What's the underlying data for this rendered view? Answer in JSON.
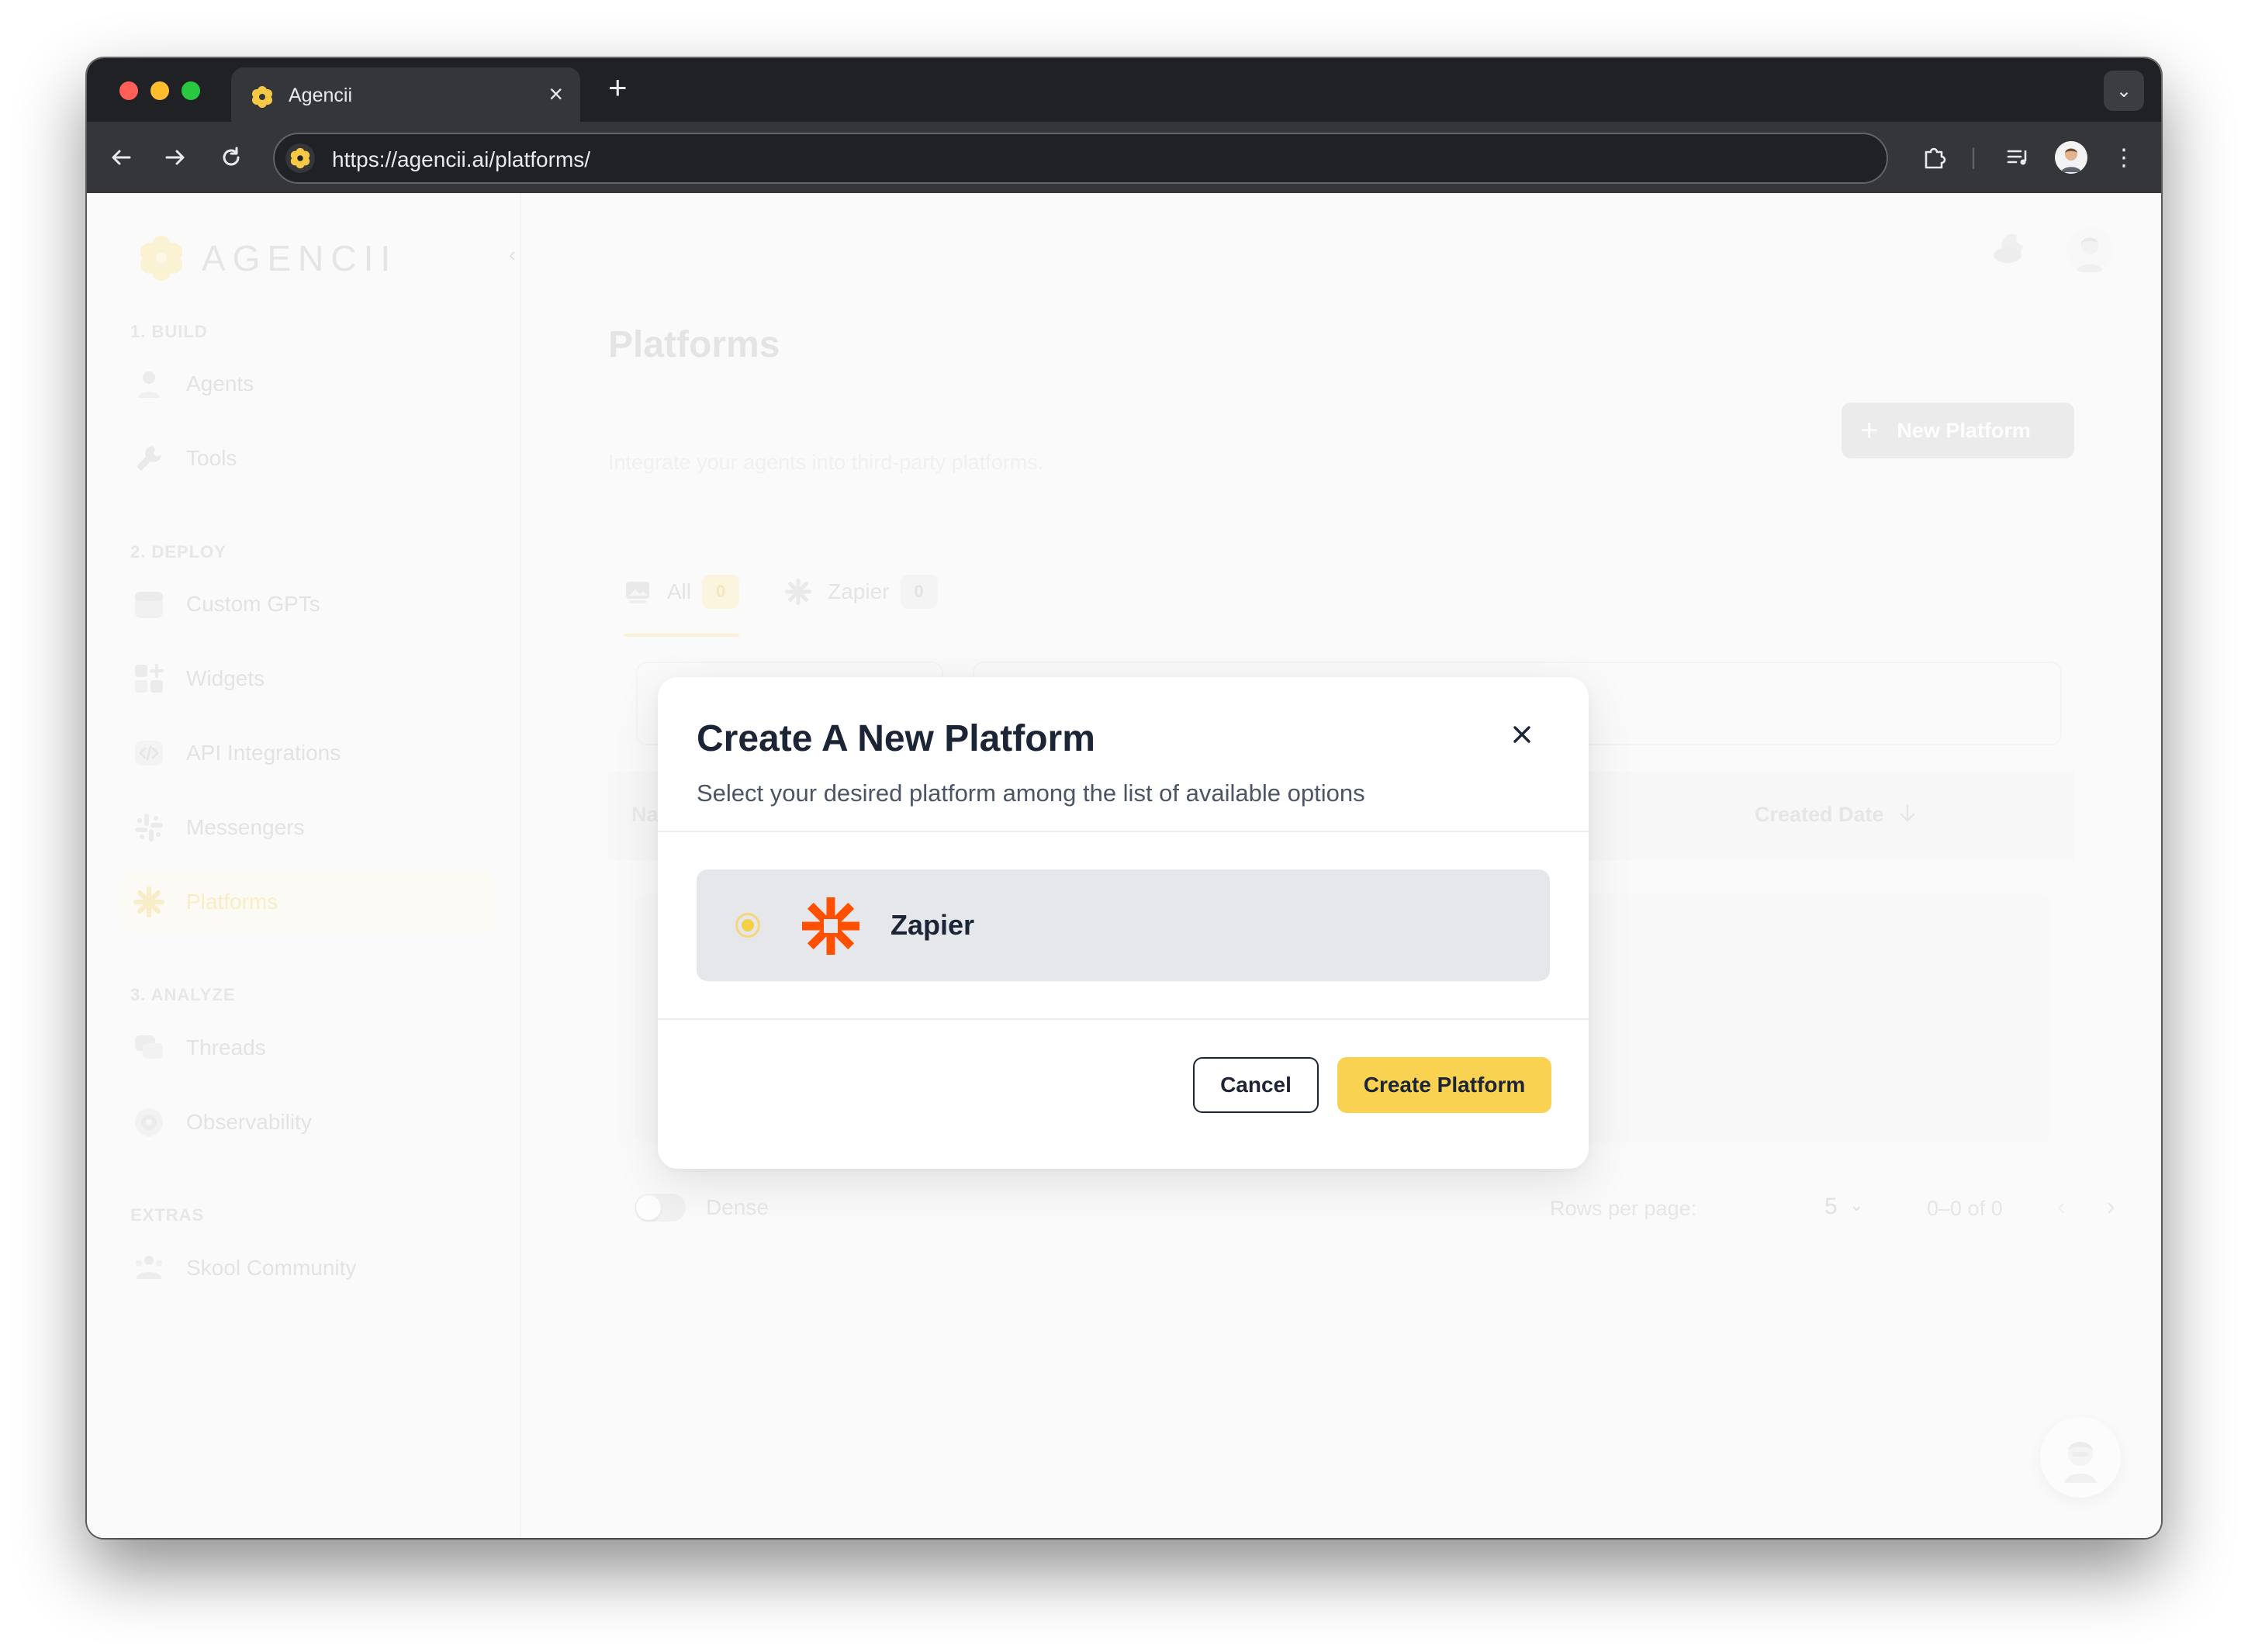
{
  "browser": {
    "tab_title": "Agencii",
    "url": "https://agencii.ai/platforms/"
  },
  "brand": {
    "name": "AGENCII",
    "accent_color": "#f8d250"
  },
  "sidebar": {
    "sections": [
      {
        "label": "1. BUILD",
        "items": [
          {
            "label": "Agents",
            "icon": "user-icon"
          },
          {
            "label": "Tools",
            "icon": "wrench-icon"
          }
        ]
      },
      {
        "label": "2. DEPLOY",
        "items": [
          {
            "label": "Custom GPTs",
            "icon": "gpt-icon"
          },
          {
            "label": "Widgets",
            "icon": "widgets-icon"
          },
          {
            "label": "API Integrations",
            "icon": "code-icon"
          },
          {
            "label": "Messengers",
            "icon": "slack-icon"
          },
          {
            "label": "Platforms",
            "icon": "asterisk-icon",
            "active": true
          }
        ]
      },
      {
        "label": "3. ANALYZE",
        "items": [
          {
            "label": "Threads",
            "icon": "chat-bubbles-icon"
          },
          {
            "label": "Observability",
            "icon": "eye-icon"
          }
        ]
      },
      {
        "label": "EXTRAS",
        "items": [
          {
            "label": "Skool Community",
            "icon": "community-icon"
          }
        ]
      }
    ]
  },
  "page": {
    "title": "Platforms",
    "subtitle": "Integrate your agents into third-party platforms.",
    "new_button_label": "New Platform"
  },
  "tabs": [
    {
      "label": "All",
      "count": "0",
      "active": true
    },
    {
      "label": "Zapier",
      "count": "0",
      "active": false
    }
  ],
  "table": {
    "columns": {
      "name": "Na",
      "created_date": "Created Date"
    }
  },
  "footer": {
    "dense_label": "Dense",
    "rows_per_page_label": "Rows per page:",
    "rows_per_page_value": "5",
    "range": "0–0 of 0"
  },
  "modal": {
    "title": "Create A New Platform",
    "subtitle": "Select your desired platform among the list of available options",
    "options": [
      {
        "label": "Zapier",
        "selected": true,
        "brand_color": "#ff4f00"
      }
    ],
    "cancel_label": "Cancel",
    "create_label": "Create Platform"
  }
}
